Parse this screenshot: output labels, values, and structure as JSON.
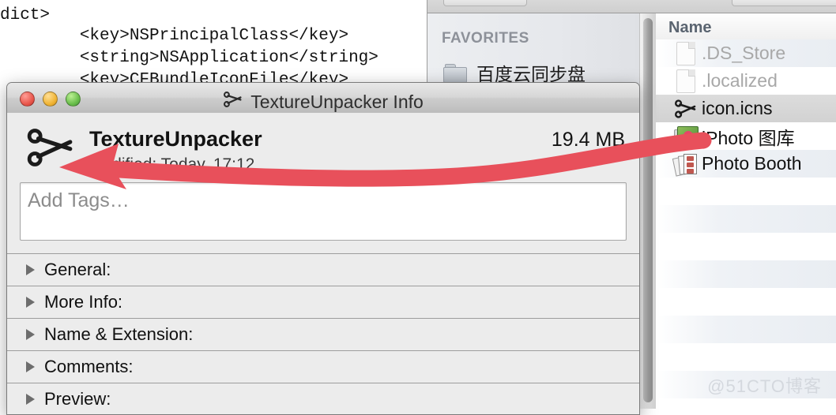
{
  "editor": {
    "lines": [
      "    </dict>",
      "dict>",
      "        <key>NSPrincipalClass</key>",
      "        <string>NSApplication</string>",
      "        <key>CFBundleIconFile</key>"
    ]
  },
  "finder": {
    "sidebar": {
      "section_label": "FAVORITES",
      "items": [
        {
          "label": "百度云同步盘",
          "icon": "folder-icon"
        }
      ]
    },
    "list": {
      "columns": [
        "Name"
      ],
      "rows": [
        {
          "name": ".DS_Store",
          "icon": "blank-document-icon",
          "dimmed": true,
          "selected": false
        },
        {
          "name": ".localized",
          "icon": "blank-document-icon",
          "dimmed": true,
          "selected": false
        },
        {
          "name": "icon.icns",
          "icon": "scissors-icon",
          "dimmed": false,
          "selected": true
        },
        {
          "name": "iPhoto 图库",
          "icon": "iphoto-icon",
          "dimmed": false,
          "selected": false
        },
        {
          "name": "Photo Booth",
          "icon": "photo-booth-icon",
          "dimmed": false,
          "selected": false
        }
      ]
    }
  },
  "info_window": {
    "title": "TextureUnpacker Info",
    "title_icon": "scissors-icon",
    "traffic_lights": {
      "close": "close-button",
      "minimize": "minimize-button",
      "zoom": "zoom-button"
    },
    "app_icon": "scissors-icon",
    "app_name": "TextureUnpacker",
    "app_size": "19.4 MB",
    "modified": "Modified: Today, 17:12",
    "tags_placeholder": "Add Tags…",
    "tags_value": "",
    "sections": [
      {
        "label": "General:",
        "expanded": false
      },
      {
        "label": "More Info:",
        "expanded": false
      },
      {
        "label": "Name & Extension:",
        "expanded": false
      },
      {
        "label": "Comments:",
        "expanded": false
      },
      {
        "label": "Preview:",
        "expanded": false
      }
    ]
  },
  "annotation": {
    "color": "#e8505b",
    "shape": "left-pointing-arrow"
  },
  "watermark": "@51CTO博客"
}
